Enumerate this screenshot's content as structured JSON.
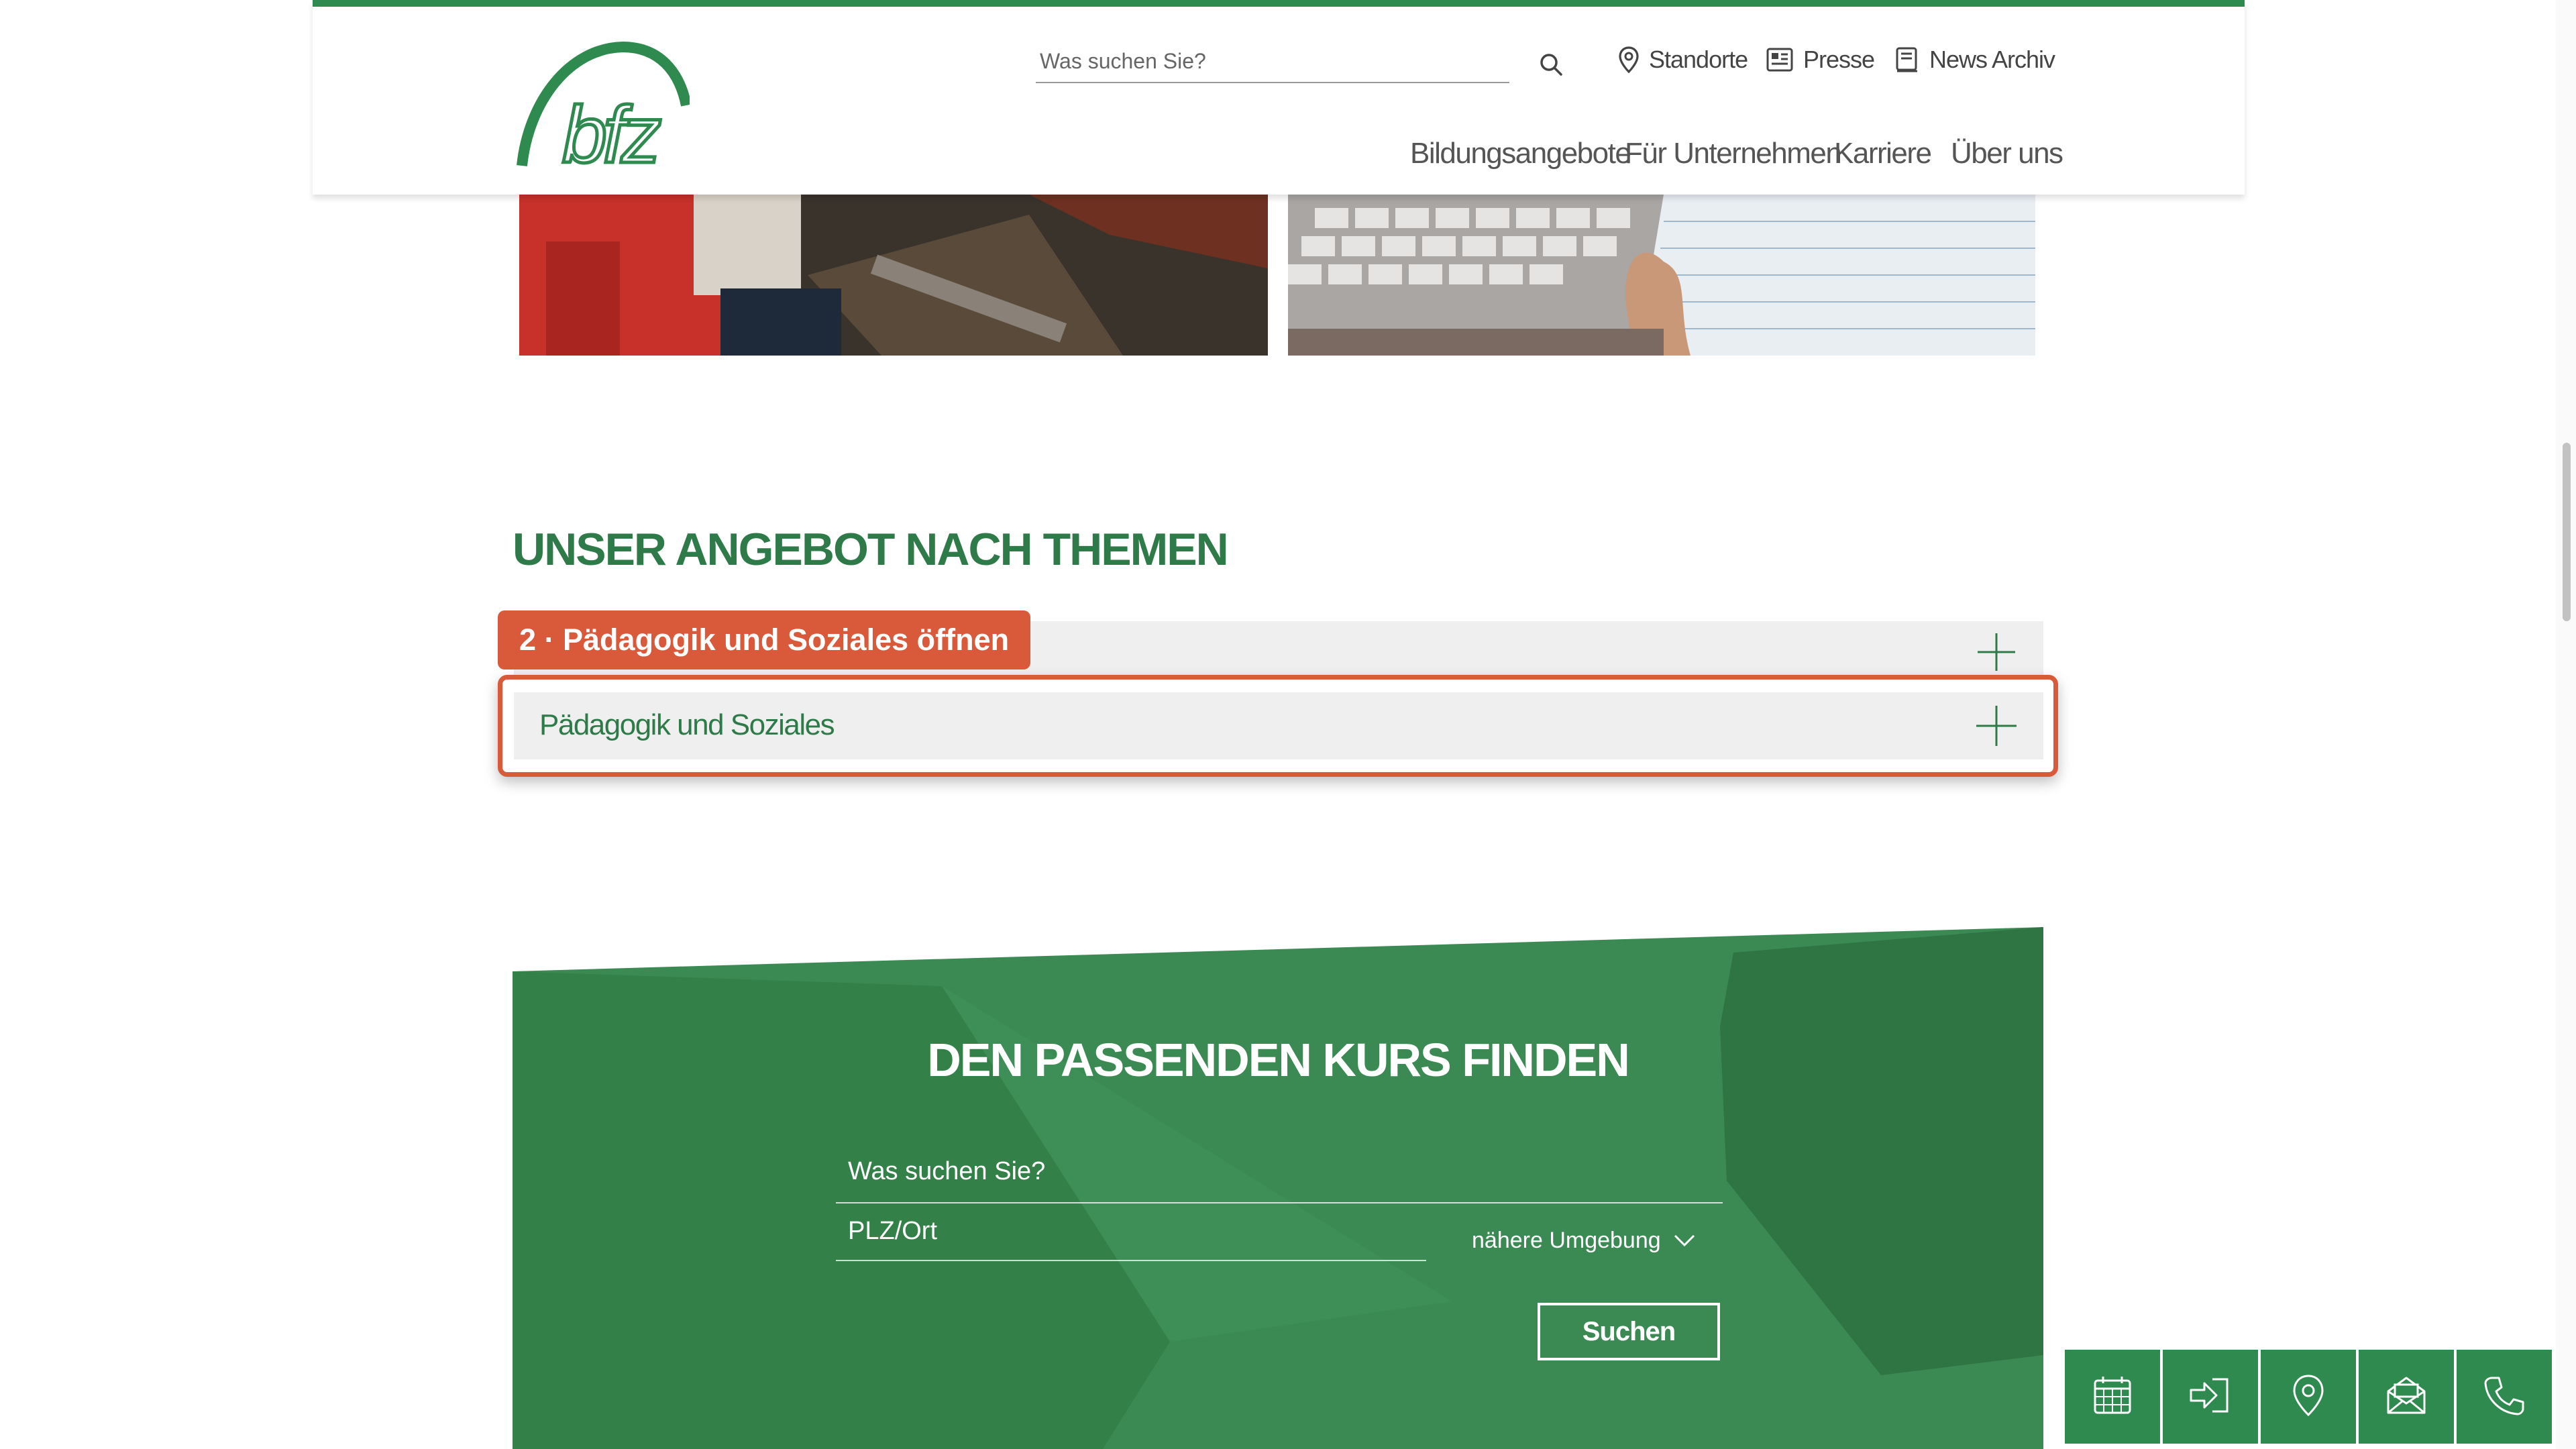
{
  "header": {
    "search_placeholder": "Was suchen Sie?",
    "utility_links": [
      "Standorte",
      "Presse",
      "News Archiv"
    ],
    "main_nav": [
      "Bildungsangebote",
      "Für Unternehmen",
      "Karriere",
      "Über uns"
    ]
  },
  "logo": {
    "text": "bfz"
  },
  "section": {
    "title": "UNSER ANGEBOT NACH THEMEN"
  },
  "accordion": {
    "annotation_label": "2 · Pädagogik und Soziales öffnen",
    "item_label": "Pädagogik und Soziales"
  },
  "finder": {
    "title": "DEN PASSENDEN KURS FINDEN",
    "query_placeholder": "Was suchen Sie?",
    "location_placeholder": "PLZ/Ort",
    "radius_value": "nähere Umgebung",
    "submit_label": "Suchen"
  },
  "quickbar": {
    "icons": [
      "calendar-icon",
      "login-icon",
      "location-pin-icon",
      "mail-icon",
      "phone-icon"
    ]
  },
  "colors": {
    "brand_green": "#2e8a4e",
    "heading_green": "#2e7a48",
    "annotation_red": "#d95a3a",
    "accordion_bg": "#efefef"
  }
}
